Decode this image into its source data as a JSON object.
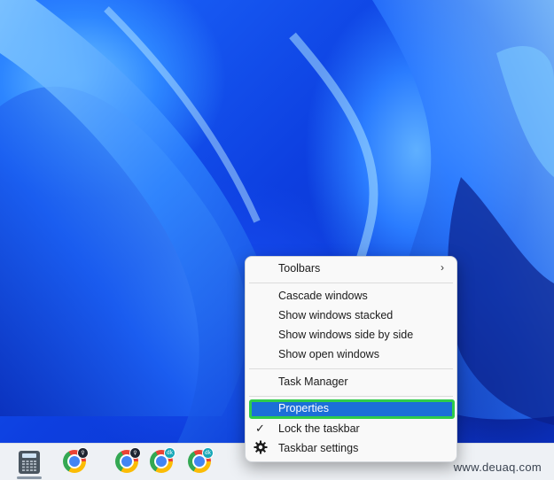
{
  "menu": {
    "items": [
      {
        "label": "Toolbars",
        "has_submenu": true
      },
      {
        "label": "Cascade windows"
      },
      {
        "label": "Show windows stacked"
      },
      {
        "label": "Show windows side by side"
      },
      {
        "label": "Show open windows"
      },
      {
        "label": "Task Manager"
      },
      {
        "label": "Properties",
        "highlighted": true
      },
      {
        "label": "Lock the taskbar",
        "checked": true
      },
      {
        "label": "Taskbar settings",
        "icon": "gear-icon"
      }
    ],
    "submenu_glyph": "›",
    "check_glyph": "✓"
  },
  "taskbar": {
    "apps": [
      {
        "name": "calculator",
        "icon": "calculator-icon"
      },
      {
        "name": "chrome-profile-1",
        "icon": "chrome-icon",
        "badge": "♀"
      },
      {
        "name": "chrome-profile-2",
        "icon": "chrome-icon",
        "badge": "♀"
      },
      {
        "name": "chrome-profile-3",
        "icon": "chrome-icon",
        "badge": "dk"
      },
      {
        "name": "chrome-profile-4",
        "icon": "chrome-icon",
        "badge": "dk"
      }
    ]
  },
  "watermark": "www.deuaq.com",
  "colors": {
    "highlight_fill": "#1b6fd8",
    "highlight_border": "#2fcc4a",
    "wallpaper_blue": "#0d3fe0"
  }
}
